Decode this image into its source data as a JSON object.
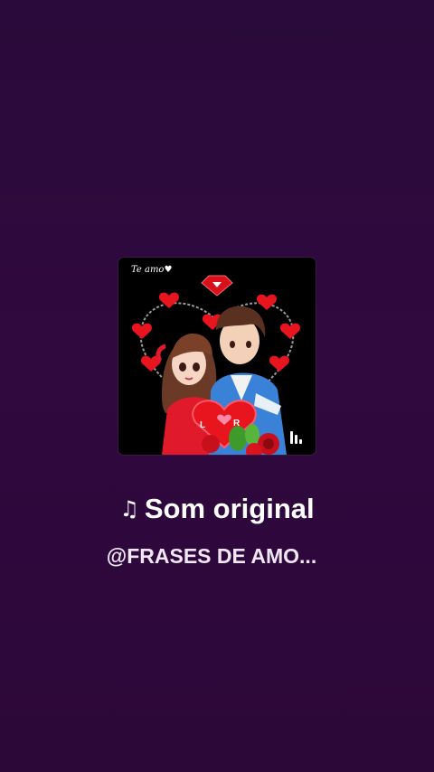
{
  "background_color": "#2c0838",
  "cover": {
    "caption": "Te amo♥",
    "badge_letters": "L R",
    "hearts_color": "#e8141e",
    "icon": "music-bars-icon"
  },
  "sound": {
    "title": "Som original",
    "title_icon": "♫",
    "author": "@FRASES DE AMO..."
  }
}
